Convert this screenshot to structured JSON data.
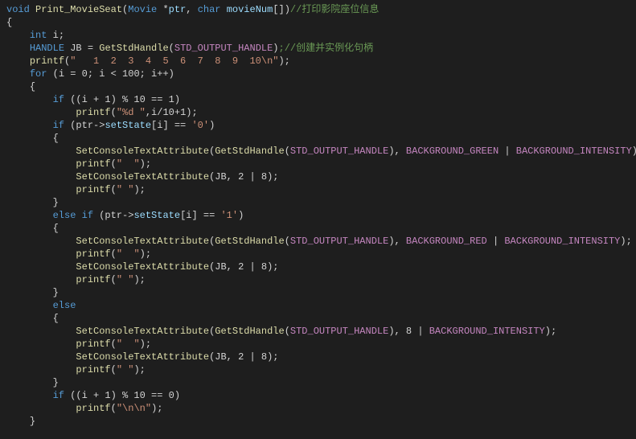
{
  "code": {
    "l1_void": "void",
    "l1_func": "Print_MovieSeat",
    "l1_p1type": "Movie",
    "l1_p1name": "ptr",
    "l1_p2type": "char",
    "l1_p2name": "movieNum",
    "l1_comment": "//打印影院座位信息",
    "l2_brace": "{",
    "l3_int": "int",
    "l3_var": " i;",
    "l4_handle": "HANDLE",
    "l4_jb": " JB = ",
    "l4_func": "GetStdHandle",
    "l4_macro": "STD_OUTPUT_HANDLE",
    "l4_comment": ";//创建并实例化句柄",
    "l5_printf": "printf",
    "l5_str": "\"   1  2  3  4  5  6  7  8  9  10\\n\"",
    "l6_for": "for",
    "l6_cond": " (i = 0; i < 100; i++)",
    "l7_brace": "{",
    "l8_if": "if",
    "l8_cond": " ((i + 1) % 10 == 1)",
    "l9_printf": "printf",
    "l9_str": "\"%d \"",
    "l9_rest": ",i/10+1);",
    "l10_if": "if",
    "l10_cond1": " (ptr->",
    "l10_field": "setState",
    "l10_cond2": "[i] == ",
    "l10_char": "'0'",
    "l10_cond3": ")",
    "l11_brace": "{",
    "l12_func": "SetConsoleTextAttribute",
    "l12_func2": "GetStdHandle",
    "l12_macro1": "STD_OUTPUT_HANDLE",
    "l12_macro2": "BACKGROUND_GREEN",
    "l12_macro3": "BACKGROUND_INTENSITY",
    "l13_printf": "printf",
    "l13_str": "\"  \"",
    "l14_func": "SetConsoleTextAttribute",
    "l14_args": "(JB, 2 | 8);",
    "l15_printf": "printf",
    "l15_str": "\" \"",
    "l16_brace": "}",
    "l17_else": "else if",
    "l17_cond1": " (ptr->",
    "l17_field": "setState",
    "l17_cond2": "[i] == ",
    "l17_char": "'1'",
    "l17_cond3": ")",
    "l18_brace": "{",
    "l19_func": "SetConsoleTextAttribute",
    "l19_func2": "GetStdHandle",
    "l19_macro1": "STD_OUTPUT_HANDLE",
    "l19_macro2": "BACKGROUND_RED",
    "l19_macro3": "BACKGROUND_INTENSITY",
    "l20_printf": "printf",
    "l20_str": "\"  \"",
    "l21_func": "SetConsoleTextAttribute",
    "l21_args": "(JB, 2 | 8);",
    "l22_printf": "printf",
    "l22_str": "\" \"",
    "l23_brace": "}",
    "l24_else": "else",
    "l25_brace": "{",
    "l26_func": "SetConsoleTextAttribute",
    "l26_func2": "GetStdHandle",
    "l26_macro1": "STD_OUTPUT_HANDLE",
    "l26_args": "), 8 | ",
    "l26_macro2": "BACKGROUND_INTENSITY",
    "l27_printf": "printf",
    "l27_str": "\"  \"",
    "l28_func": "SetConsoleTextAttribute",
    "l28_args": "(JB, 2 | 8);",
    "l29_printf": "printf",
    "l29_str": "\" \"",
    "l30_brace": "}",
    "l31_if": "if",
    "l31_cond": " ((i + 1) % 10 == 0)",
    "l32_printf": "printf",
    "l32_str": "\"\\n\\n\"",
    "l33_brace": "}"
  }
}
